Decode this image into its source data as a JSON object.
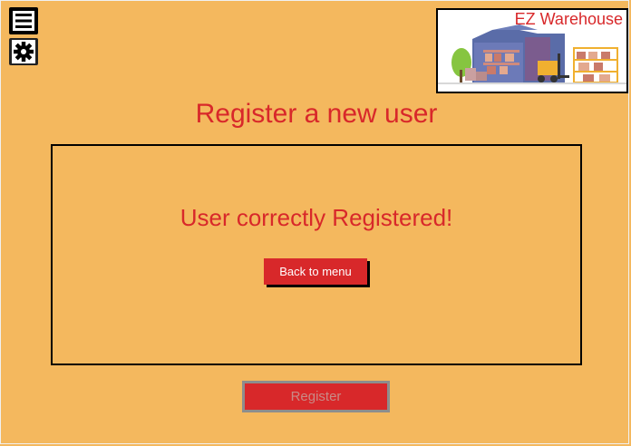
{
  "logo": {
    "title": "EZ Warehouse"
  },
  "page": {
    "title": "Register a new user"
  },
  "panel": {
    "message": "User correctly Registered!",
    "back_label": "Back to menu"
  },
  "form": {
    "register_label": "Register"
  },
  "icons": {
    "menu": "hamburger-menu-icon",
    "settings": "gear-icon"
  },
  "colors": {
    "background": "#f4b85e",
    "accent": "#d8282a"
  }
}
